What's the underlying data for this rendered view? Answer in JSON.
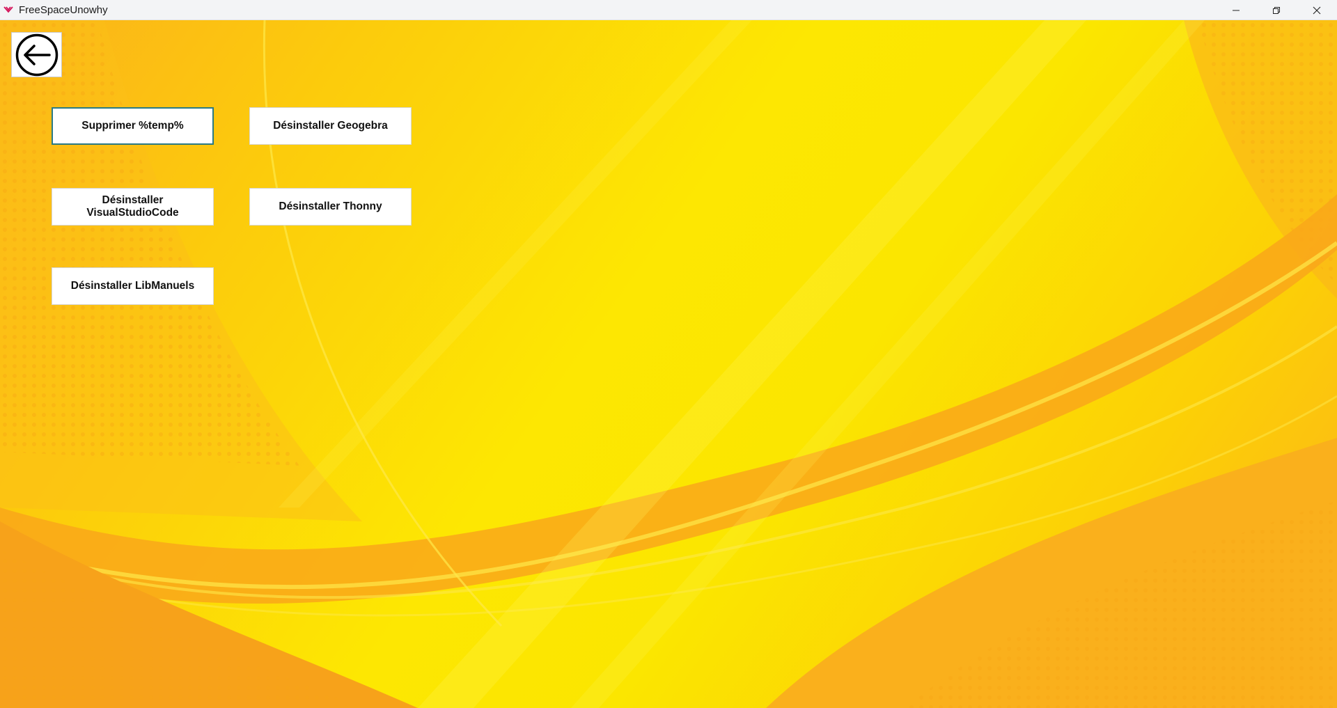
{
  "window": {
    "title": "FreeSpaceUnowhy",
    "controls": {
      "minimize": "minimize-icon",
      "restore": "restore-icon",
      "close": "close-icon"
    }
  },
  "navigation": {
    "back_icon": "arrow-left-circle-icon"
  },
  "actions": [
    {
      "label": "Supprimer %temp%",
      "focused": true
    },
    {
      "label": "Désinstaller Geogebra"
    },
    {
      "label": "Désinstaller VisualStudioCode"
    },
    {
      "label": "Désinstaller Thonny"
    },
    {
      "label": "Désinstaller LibManuels"
    }
  ],
  "colors": {
    "accent_focus": "#2a7a85",
    "background_yellow": "#fde702",
    "background_orange": "#fbb21b"
  }
}
